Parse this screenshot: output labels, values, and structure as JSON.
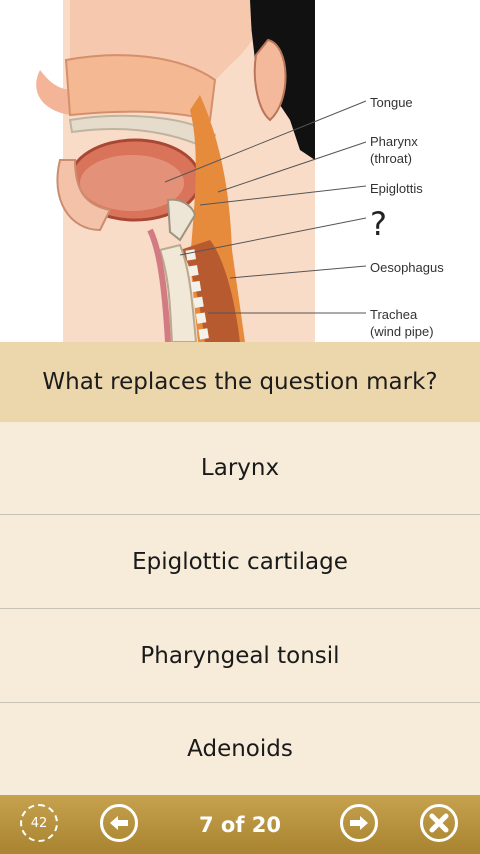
{
  "diagram": {
    "labels": {
      "tongue": "Tongue",
      "pharynx": "Pharynx\n(throat)",
      "epiglottis": "Epiglottis",
      "unknown": "?",
      "oesophagus": "Oesophagus",
      "trachea": "Trachea\n(wind pipe)"
    }
  },
  "question": "What replaces the question mark?",
  "answers": [
    "Larynx",
    "Epiglottic cartilage",
    "Pharyngeal tonsil",
    "Adenoids"
  ],
  "toolbar": {
    "score_value": "42",
    "progress": "7 of 20"
  },
  "colors": {
    "question_bg": "#ecd7ad",
    "answer_bg": "#f6ecd9",
    "toolbar": "#b8953f",
    "skin": "#f6c9ae",
    "muscle": "#c8573a"
  }
}
